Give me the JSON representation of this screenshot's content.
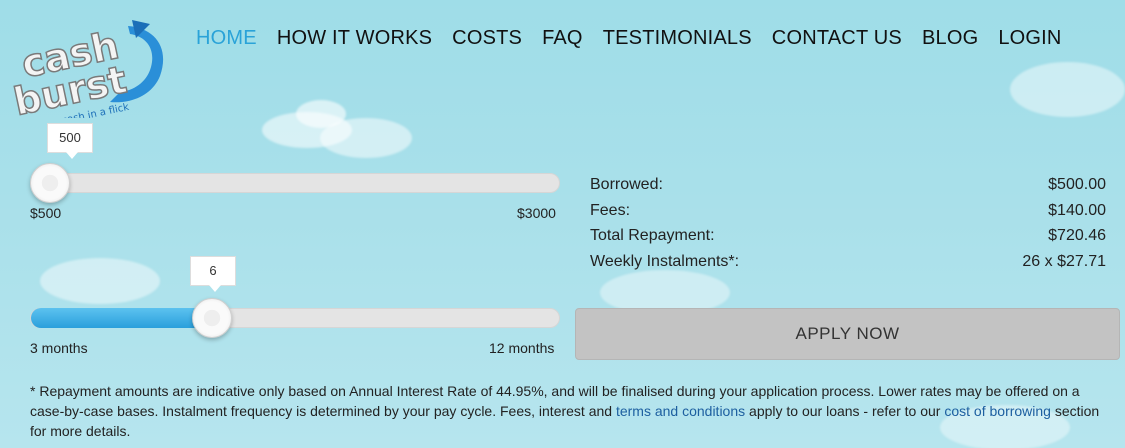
{
  "logo": {
    "line1": "cash",
    "line2": "burst",
    "tagline": "cash in a flick"
  },
  "nav": [
    {
      "label": "HOME",
      "active": true
    },
    {
      "label": "HOW IT WORKS"
    },
    {
      "label": "COSTS"
    },
    {
      "label": "FAQ"
    },
    {
      "label": "TESTIMONIALS"
    },
    {
      "label": "CONTACT US"
    },
    {
      "label": "BLOG"
    },
    {
      "label": "LOGIN"
    }
  ],
  "amount_slider": {
    "value": "500",
    "min_label": "$500",
    "max_label": "$3000",
    "fraction": 0.0
  },
  "term_slider": {
    "value": "6",
    "min_label": "3 months",
    "max_label": "12 months",
    "fraction": 0.33
  },
  "summary": {
    "borrowed_label": "Borrowed:",
    "borrowed_value": "$500.00",
    "fees_label": "Fees:",
    "fees_value": "$140.00",
    "total_label": "Total Repayment:",
    "total_value": "$720.46",
    "weekly_label": "Weekly Instalments*:",
    "weekly_value": "26 x $27.71"
  },
  "apply_label": "APPLY NOW",
  "note": {
    "part1": "* Repayment amounts are indicative only based on Annual Interest Rate of 44.95%, and will be finalised during your application process. Lower rates may be offered on a case-by-case bases. Instalment frequency is determined by your pay cycle. Fees, interest and ",
    "link1": "terms and conditions",
    "part2": " apply to our loans - refer to our ",
    "link2": "cost of borrowing",
    "part3": " section for more details."
  },
  "colors": {
    "accent": "#2aa3d8",
    "link": "#1d5fa0",
    "button": "#c3c3c3"
  }
}
